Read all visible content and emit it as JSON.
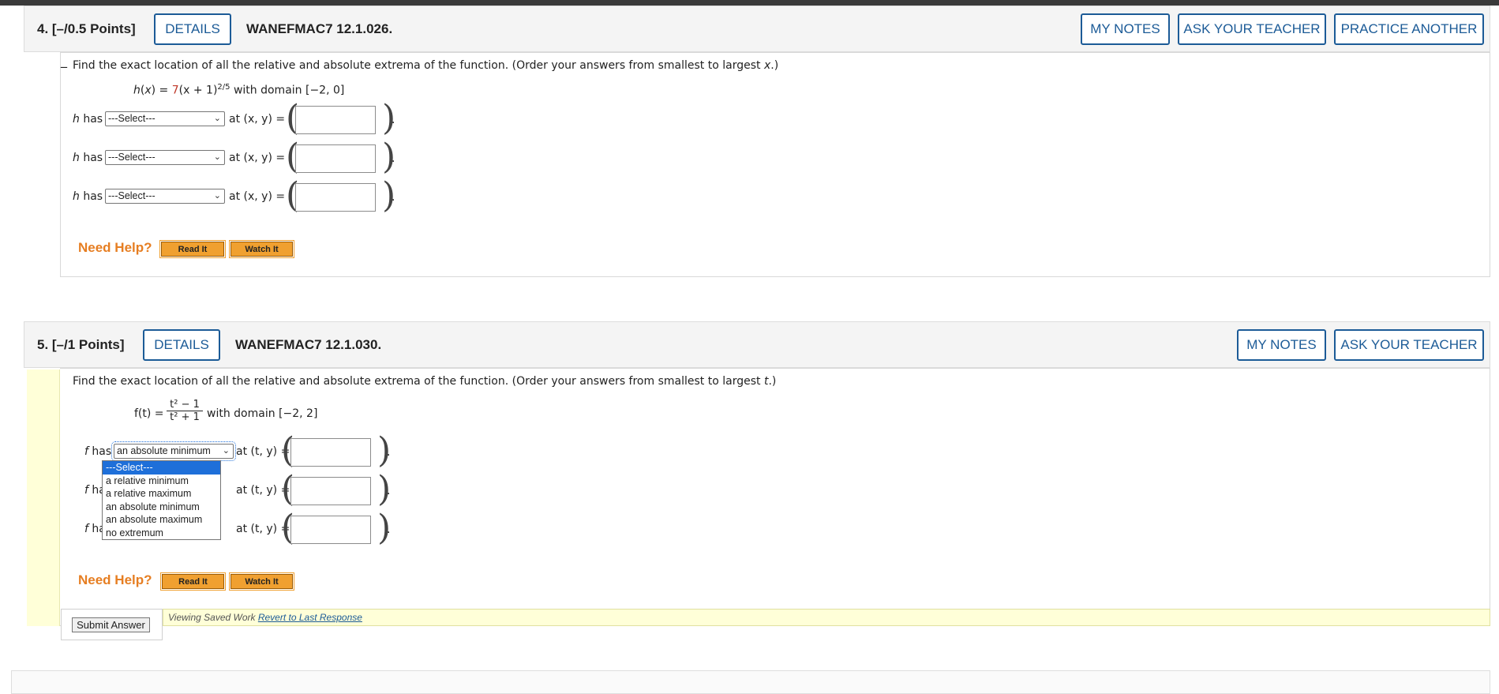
{
  "q4": {
    "number": "4. [–/0.5 Points]",
    "details_label": "DETAILS",
    "code": "WANEFMAC7 12.1.026.",
    "my_notes_label": "MY NOTES",
    "ask_teacher_label": "ASK YOUR TEACHER",
    "practice_label": "PRACTICE ANOTHER",
    "prompt_main": "Find the exact location of all the relative and absolute extrema of the function. (Order your answers from smallest to largest ",
    "prompt_var": "x",
    "prompt_end": ".)",
    "func_name": "h",
    "func_var": "x",
    "func_coef": "7",
    "func_inner": "(x + 1)",
    "func_exp": "2/5",
    "func_domain": "with domain [−2, 0]",
    "rows": [
      {
        "label": "has",
        "select": "---Select---",
        "at": "at (x, y) ="
      },
      {
        "label": "has",
        "select": "---Select---",
        "at": "at (x, y) ="
      },
      {
        "label": "has",
        "select": "---Select---",
        "at": "at (x, y) ="
      }
    ],
    "need_help": "Need Help?",
    "read_it": "Read It",
    "watch_it": "Watch It"
  },
  "q5": {
    "number": "5. [–/1 Points]",
    "details_label": "DETAILS",
    "code": "WANEFMAC7 12.1.030.",
    "my_notes_label": "MY NOTES",
    "ask_teacher_label": "ASK YOUR TEACHER",
    "prompt_main": "Find the exact location of all the relative and absolute extrema of the function. (Order your answers from smallest to largest ",
    "prompt_var": "t",
    "prompt_end": ".)",
    "func_lhs": "f(t) =",
    "func_num": "t² − 1",
    "func_den": "t² + 1",
    "func_domain": "with domain [−2, 2]",
    "rows": [
      {
        "label": "has",
        "select": "an absolute minimum",
        "at": "at (t, y) ="
      },
      {
        "label": "has",
        "select": "",
        "at": "at (t, y) ="
      },
      {
        "label": "has",
        "select": "",
        "at": "at (t, y) ="
      }
    ],
    "dropdown_options": [
      "---Select---",
      "a relative minimum",
      "a relative maximum",
      "an absolute minimum",
      "an absolute maximum",
      "no extremum"
    ],
    "need_help": "Need Help?",
    "read_it": "Read It",
    "watch_it": "Watch It",
    "saved_text": "Viewing Saved Work ",
    "revert_link": "Revert to Last Response",
    "submit_label": "Submit Answer"
  },
  "colors": {
    "accent_blue": "#1c5b97",
    "need_help_orange": "#e67e22",
    "help_button": "#f0a030",
    "saved_yellow": "#ffffd8",
    "dropdown_highlight": "#1e6fd9"
  }
}
